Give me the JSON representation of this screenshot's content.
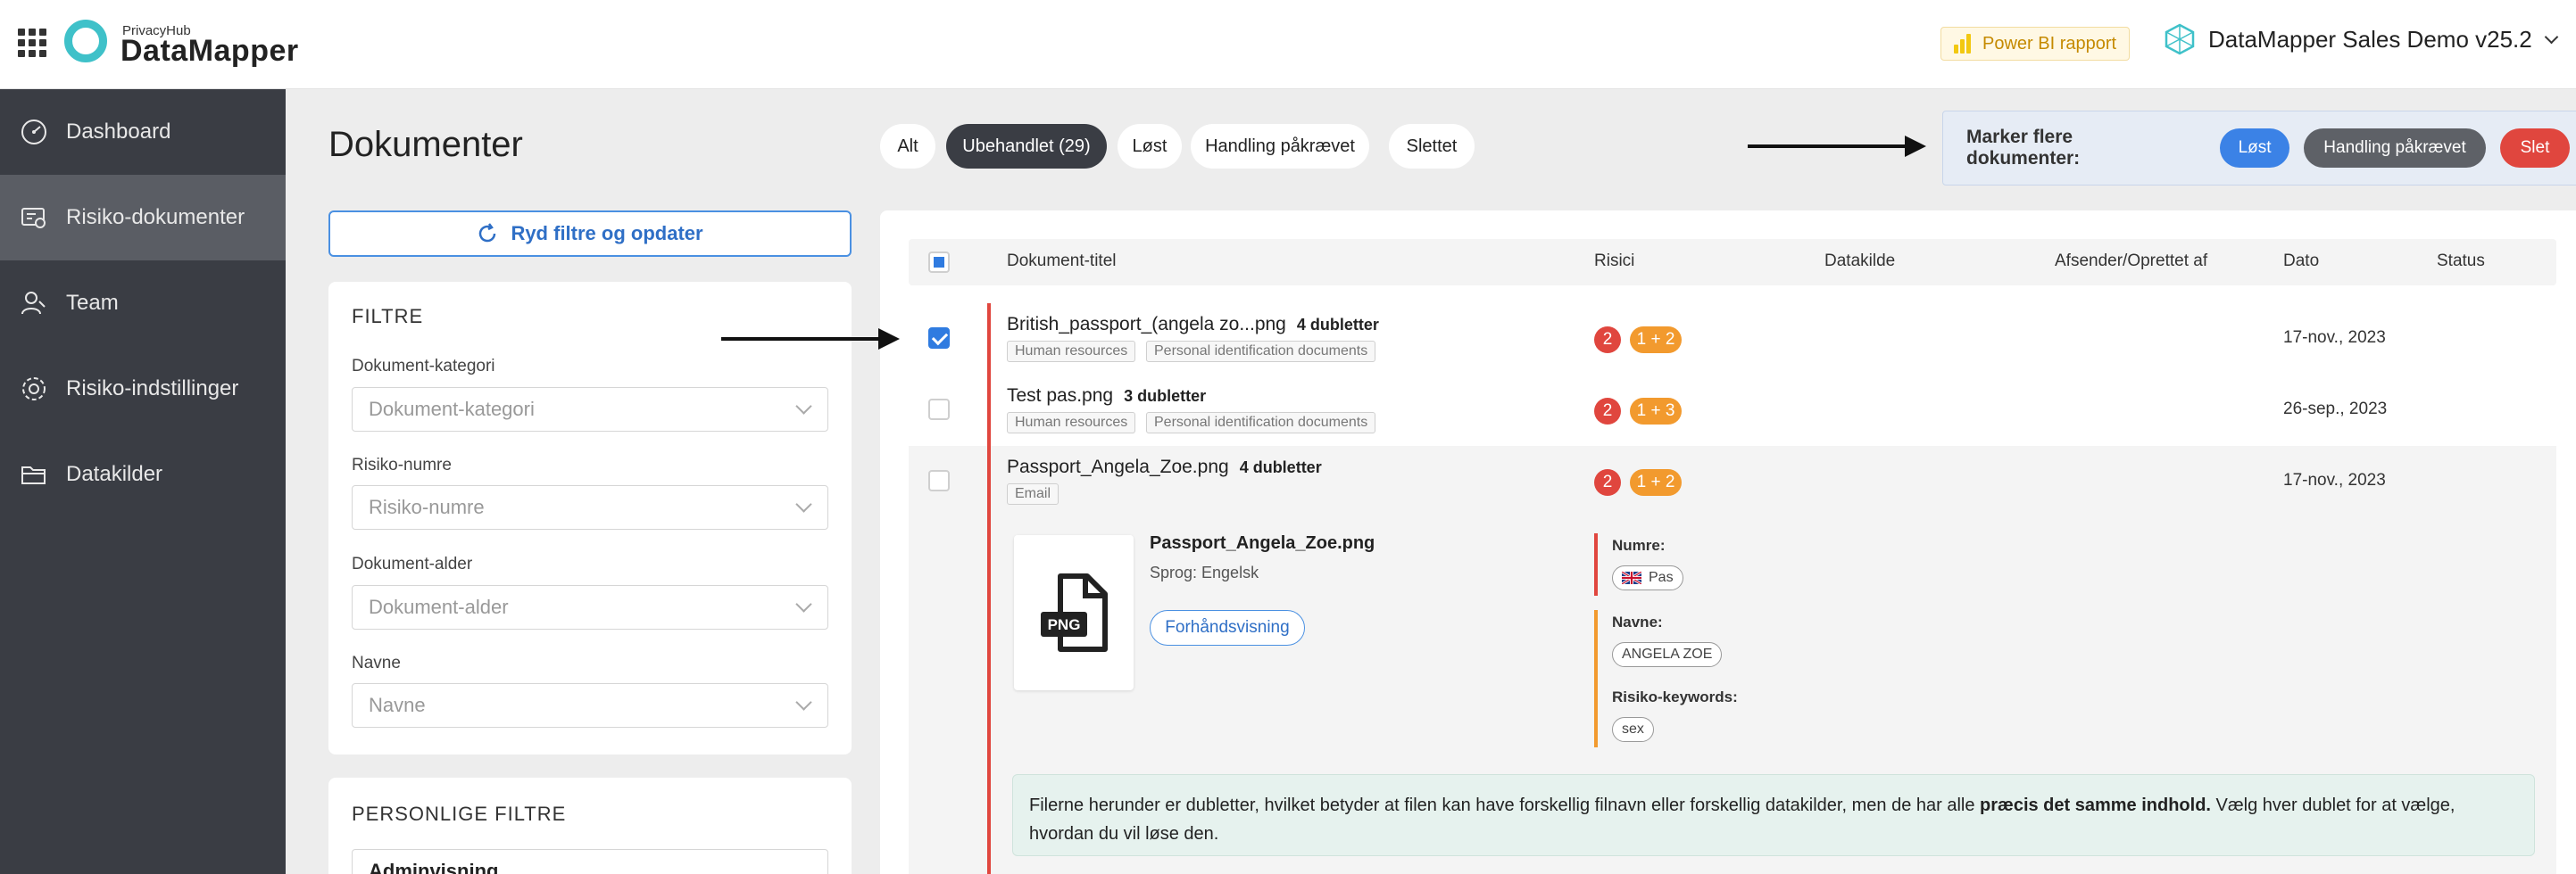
{
  "header": {
    "brand_small": "PrivacyHub",
    "brand_big": "DataMapper",
    "powerbi_label": "Power BI rapport",
    "workspace_title": "DataMapper Sales Demo v25.2"
  },
  "sidebar": {
    "items": [
      {
        "label": "Dashboard",
        "icon": "gauge-icon"
      },
      {
        "label": "Risiko-dokumenter",
        "icon": "document-risk-icon",
        "active": true
      },
      {
        "label": "Team",
        "icon": "people-icon"
      },
      {
        "label": "Risiko-indstillinger",
        "icon": "gear-icon"
      },
      {
        "label": "Datakilder",
        "icon": "folder-icon"
      }
    ]
  },
  "page": {
    "title": "Dokumenter",
    "status_filters": [
      "Alt",
      "Ubehandlet (29)",
      "Løst",
      "Handling påkrævet",
      "Slettet"
    ],
    "active_filter": "Ubehandlet (29)"
  },
  "bulk": {
    "label": "Marker flere dokumenter:",
    "resolved": "Løst",
    "action_required": "Handling påkrævet",
    "delete": "Slet"
  },
  "filters": {
    "refresh_label": "Ryd filtre og opdater",
    "title": "FILTRE",
    "fields": [
      {
        "label": "Dokument-kategori",
        "placeholder": "Dokument-kategori"
      },
      {
        "label": "Risiko-numre",
        "placeholder": "Risiko-numre"
      },
      {
        "label": "Dokument-alder",
        "placeholder": "Dokument-alder"
      },
      {
        "label": "Navne",
        "placeholder": "Navne"
      }
    ],
    "personal_title": "PERSONLIGE FILTRE",
    "personal_value": "Adminvisning"
  },
  "table": {
    "columns": [
      "Dokument-titel",
      "Risici",
      "Datakilde",
      "Afsender/Oprettet af",
      "Dato",
      "Status"
    ],
    "rows": [
      {
        "name": "British_passport_(angela zo...png",
        "dups": "4 dubletter",
        "tags": [
          "Human resources",
          "Personal identification documents"
        ],
        "risk_red": "2",
        "risk_orange": "1 + 2",
        "date": "17-nov., 2023",
        "checked": true
      },
      {
        "name": "Test pas.png",
        "dups": "3 dubletter",
        "tags": [
          "Human resources",
          "Personal identification documents"
        ],
        "risk_red": "2",
        "risk_orange": "1 + 3",
        "date": "26-sep., 2023",
        "checked": false
      },
      {
        "name": "Passport_Angela_Zoe.png",
        "dups": "4 dubletter",
        "tags": [
          "Email"
        ],
        "risk_red": "2",
        "risk_orange": "1 + 2",
        "date": "17-nov., 2023",
        "checked": false
      }
    ]
  },
  "detail": {
    "file_badge": "PNG",
    "title": "Passport_Angela_Zoe.png",
    "language": "Sprog: Engelsk",
    "preview": "Forhåndsvisning",
    "numre_label": "Numre:",
    "numre_value": "Pas",
    "navne_label": "Navne:",
    "navne_value": "ANGELA ZOE",
    "keywords_label": "Risiko-keywords:",
    "keywords_value": "sex",
    "info_part1": "Filerne herunder er dubletter, hvilket betyder at filen kan have forskellig filnavn eller forskellig datakilder, men de har alle ",
    "info_bold": "præcis det samme indhold.",
    "info_part2": " Vælg hver dublet for at vælge, hvordan du vil løse den."
  },
  "colors": {
    "sidebar": "#3a3d44",
    "accent_blue": "#4a90e2",
    "risk_red": "#e0463e",
    "risk_orange": "#f29a2e",
    "brand_teal": "#3fc1c9"
  }
}
